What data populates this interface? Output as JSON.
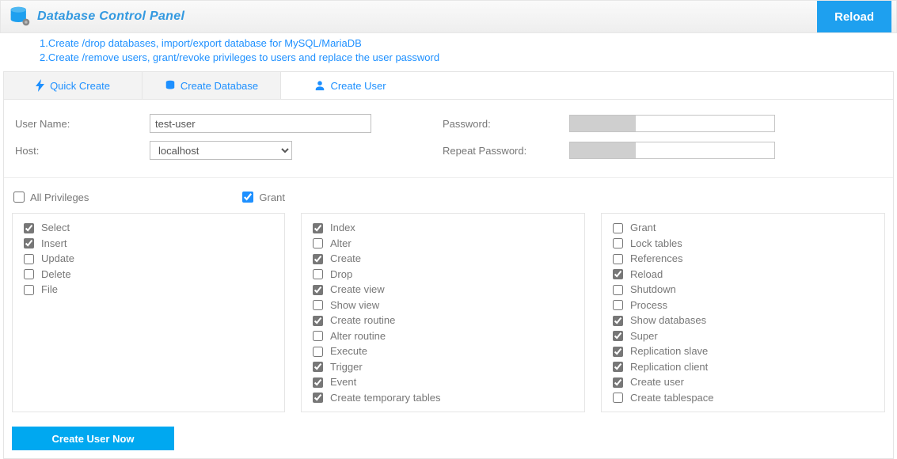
{
  "header": {
    "title": "Database Control Panel",
    "reload": "Reload"
  },
  "desc": {
    "line1": "1.Create /drop databases, import/export database for MySQL/MariaDB",
    "line2": "2.Create /remove users, grant/revoke privileges to users and replace the user password"
  },
  "tabs": {
    "quick_create": "Quick Create",
    "create_database": "Create Database",
    "create_user": "Create User"
  },
  "form": {
    "username_label": "User Name:",
    "username_value": "test-user",
    "host_label": "Host:",
    "host_value": "localhost",
    "password_label": "Password:",
    "repeat_password_label": "Repeat Password:"
  },
  "priv_head": {
    "all": "All Privileges",
    "grant": "Grant"
  },
  "privs": {
    "col1": [
      {
        "label": "Select",
        "checked": true
      },
      {
        "label": "Insert",
        "checked": true
      },
      {
        "label": "Update",
        "checked": false
      },
      {
        "label": "Delete",
        "checked": false
      },
      {
        "label": "File",
        "checked": false
      }
    ],
    "col2": [
      {
        "label": "Index",
        "checked": true
      },
      {
        "label": "Alter",
        "checked": false
      },
      {
        "label": "Create",
        "checked": true
      },
      {
        "label": "Drop",
        "checked": false
      },
      {
        "label": "Create view",
        "checked": true
      },
      {
        "label": "Show view",
        "checked": false
      },
      {
        "label": "Create routine",
        "checked": true
      },
      {
        "label": "Alter routine",
        "checked": false
      },
      {
        "label": "Execute",
        "checked": false
      },
      {
        "label": "Trigger",
        "checked": true
      },
      {
        "label": "Event",
        "checked": true
      },
      {
        "label": "Create temporary tables",
        "checked": true
      }
    ],
    "col3": [
      {
        "label": "Grant",
        "checked": false
      },
      {
        "label": "Lock tables",
        "checked": false
      },
      {
        "label": "References",
        "checked": false
      },
      {
        "label": "Reload",
        "checked": true
      },
      {
        "label": "Shutdown",
        "checked": false
      },
      {
        "label": "Process",
        "checked": false
      },
      {
        "label": "Show databases",
        "checked": true
      },
      {
        "label": "Super",
        "checked": true
      },
      {
        "label": "Replication slave",
        "checked": true
      },
      {
        "label": "Replication client",
        "checked": true
      },
      {
        "label": "Create user",
        "checked": true
      },
      {
        "label": "Create tablespace",
        "checked": false
      }
    ]
  },
  "actions": {
    "create_user_now": "Create User Now"
  }
}
